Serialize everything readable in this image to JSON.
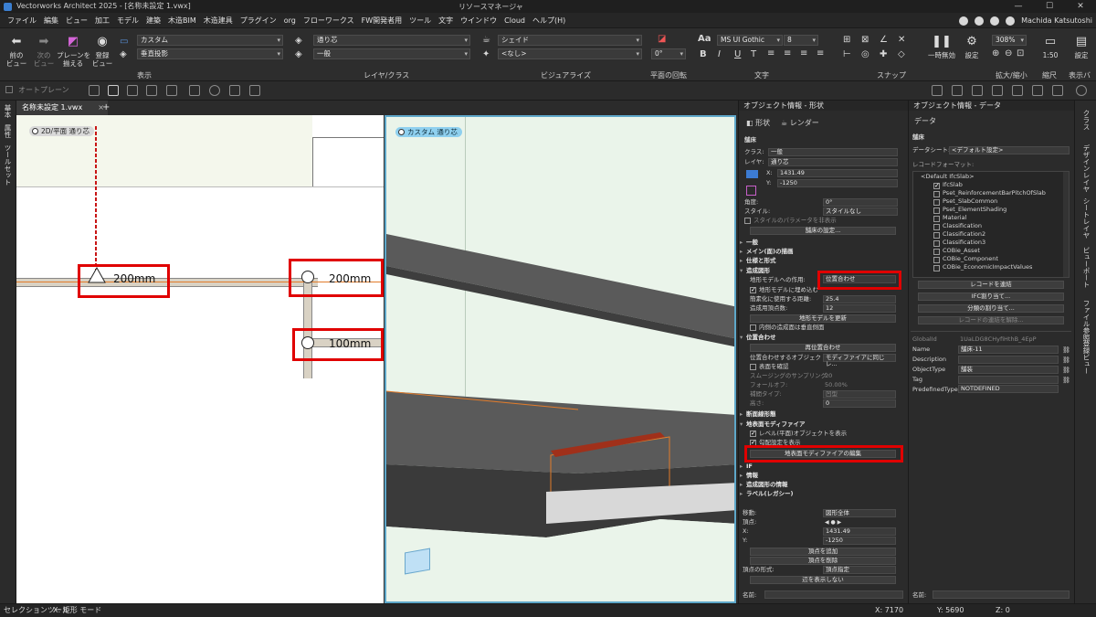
{
  "window": {
    "title": "Vectorworks Architect 2025 - [名称未設定 1.vwx]",
    "resource_manager": "リソースマネージャ",
    "user": "Machida Katsutoshi"
  },
  "menu": [
    "ファイル",
    "編集",
    "ビュー",
    "加工",
    "モデル",
    "建築",
    "木造BIM",
    "木造建具",
    "プラグイン",
    "org",
    "フローワークス",
    "FW開発者用",
    "ツール",
    "文字",
    "ウインドウ",
    "Cloud",
    "ヘルプ(H)"
  ],
  "ribbon": {
    "prev_view": "前の\nビュー",
    "next_view": "次の\nビュー",
    "align_plane": "プレーンを\n揃える",
    "register_view": "登録\nビュー",
    "view_label": "表示",
    "custom": "カスタム",
    "vertical_projection": "垂直投影",
    "layer": "通り芯",
    "class": "一般",
    "layer_class_label": "レイヤ/クラス",
    "render": "シェイド",
    "none": "<なし>",
    "visualize_label": "ビジュアライズ",
    "rotation": "0°",
    "plan_rotation_label": "平面の回転",
    "font": "MS UI Gothic",
    "font_size": "8",
    "text_label": "文字",
    "snap_label": "スナップ",
    "pause": "一時無効",
    "settings": "設定",
    "zoom": "308%",
    "zoom_label": "拡大/縮小",
    "scale": "1:50",
    "scale_label": "縮尺",
    "settings2": "設定",
    "display_bar_label": "表示バー"
  },
  "toolbar2": {
    "auto_plane": "オートプレーン"
  },
  "left_strip": [
    "基本",
    "属性",
    "ツールセット"
  ],
  "doc_tab": "名称未設定 1.vwx",
  "viewport2d": {
    "label": "2D/平面  通り芯",
    "dims": [
      "200mm",
      "200mm",
      "100mm"
    ]
  },
  "viewport3d": {
    "label": "カスタム  通り芯"
  },
  "obj_panel": {
    "title": "オブジェクト情報 - 形状",
    "tab_shape": "形状",
    "tab_render": "レンダー",
    "object_type": "舗床",
    "class_lbl": "クラス:",
    "class_val": "一般",
    "layer_lbl": "レイヤ:",
    "layer_val": "通り芯",
    "x_lbl": "X:",
    "x_val": "1431.49",
    "y_lbl": "Y:",
    "y_val": "-1250",
    "angle_lbl": "角度:",
    "angle_val": "0°",
    "style_lbl": "スタイル:",
    "style_val": "スタイルなし",
    "hide_style": "スタイルのパラメータを非表示",
    "pave_settings": "舗床の設定...",
    "s_general": "一般",
    "s_main_draw": "メイン(面)の描画",
    "s_spec": "仕様と形式",
    "s_site": "造成図形",
    "site_action_lbl": "地形モデルへの作用:",
    "site_action_val": "位置合わせ",
    "embed": "地形モデルに埋め込む",
    "surface_dist_lbl": "簡素化に使用する距離:",
    "surface_dist_val": "25.4",
    "grade_lbl": "造成用頂点数:",
    "grade_val": "12",
    "update_model": "地形モデルを更新",
    "inner_vertical": "内側の造成面は垂直側面",
    "s_align": "位置合わせ",
    "realign": "再位置合わせ",
    "align_obj_lbl": "位置合わせするオブジェクト:",
    "align_obj_val": "モディファイアに同じレ...",
    "set_surface": "表面を確認",
    "smoothing_lbl": "スムージングのサンプリング:",
    "smoothing_val": "20",
    "falloff_lbl": "フォールオフ:",
    "falloff_val": "50.00%",
    "boundary_lbl": "補間タイプ:",
    "boundary_val": "凹型",
    "height_lbl": "高さ:",
    "height_val": "0",
    "s_section": "断面線形態",
    "s_modifier": "地表面モディファイア",
    "show_level": "レベル(平面)オブジェクトを表示",
    "show_grade": "勾配設定を表示",
    "edit_modifier": "地表面モディファイアの編集",
    "s_if": "IF",
    "s_info": "情報",
    "s_grade_info": "造成図形の情報",
    "s_label": "ラベル(レガシー)",
    "move_lbl": "移動:",
    "move_val": "図形全体",
    "vertex_lbl": "頂点:",
    "vx_lbl": "X:",
    "vx_val": "1431.49",
    "vy_lbl": "Y:",
    "vy_val": "-1250",
    "add_vertex": "頂点を追加",
    "del_vertex": "頂点を削除",
    "vertex_type_lbl": "頂点の形式:",
    "vertex_type_val": "頂点指定",
    "hide_edge": "辺を表示しない",
    "name_lbl": "名前:"
  },
  "data_panel": {
    "title": "オブジェクト情報 - データ",
    "tab": "データ",
    "object_type": "舗床",
    "datasheet_lbl": "データシート:",
    "datasheet_val": "<デフォルト設定>",
    "record_format_lbl": "レコードフォーマット:",
    "records": [
      {
        "label": "<Default IfcSlab>",
        "checked": false,
        "indent": 0
      },
      {
        "label": "IfcSlab",
        "checked": true,
        "indent": 1
      },
      {
        "label": "Pset_ReinforcementBarPitchOfSlab",
        "checked": false,
        "indent": 1
      },
      {
        "label": "Pset_SlabCommon",
        "checked": false,
        "indent": 1
      },
      {
        "label": "Pset_ElementShading",
        "checked": false,
        "indent": 1
      },
      {
        "label": "Material",
        "checked": false,
        "indent": 1
      },
      {
        "label": "Classification",
        "checked": false,
        "indent": 1
      },
      {
        "label": "Classification2",
        "checked": false,
        "indent": 1
      },
      {
        "label": "Classification3",
        "checked": false,
        "indent": 1
      },
      {
        "label": "COBie_Asset",
        "checked": false,
        "indent": 1
      },
      {
        "label": "COBie_Component",
        "checked": false,
        "indent": 1
      },
      {
        "label": "COBie_EconomicImpactValues",
        "checked": false,
        "indent": 1
      }
    ],
    "link_record": "レコードを連結",
    "ifc_assign": "IFC割り当て...",
    "class_assign": "分類の割り当て...",
    "unlink_record": "レコードの連結を解除...",
    "globalid_lbl": "GlobalId",
    "globalid_val": "1UaLDG8CHyfiHthB_4EpP",
    "name_lbl": "Name",
    "name_val": "舗床-11",
    "desc_lbl": "Description",
    "objtype_lbl": "ObjectType",
    "objtype_val": "舗装",
    "tag_lbl": "Tag",
    "predef_lbl": "PredefinedType:",
    "predef_val": "NOTDEFINED",
    "name2_lbl": "名前:"
  },
  "right_strip": [
    "クラス",
    "デザインレイヤ",
    "シートレイヤ",
    "ビューポート",
    "ファイル参照",
    "登録ビュー"
  ],
  "status": {
    "tool": "セレクションツール",
    "mode": "X: 矩形 モード",
    "x": "X: 7170",
    "y": "Y: 5690",
    "z": "Z: 0"
  },
  "colors": {
    "accent_red": "#e00000",
    "viewport_border": "#5ea7c9",
    "dark_bg": "#2b2b2b"
  }
}
